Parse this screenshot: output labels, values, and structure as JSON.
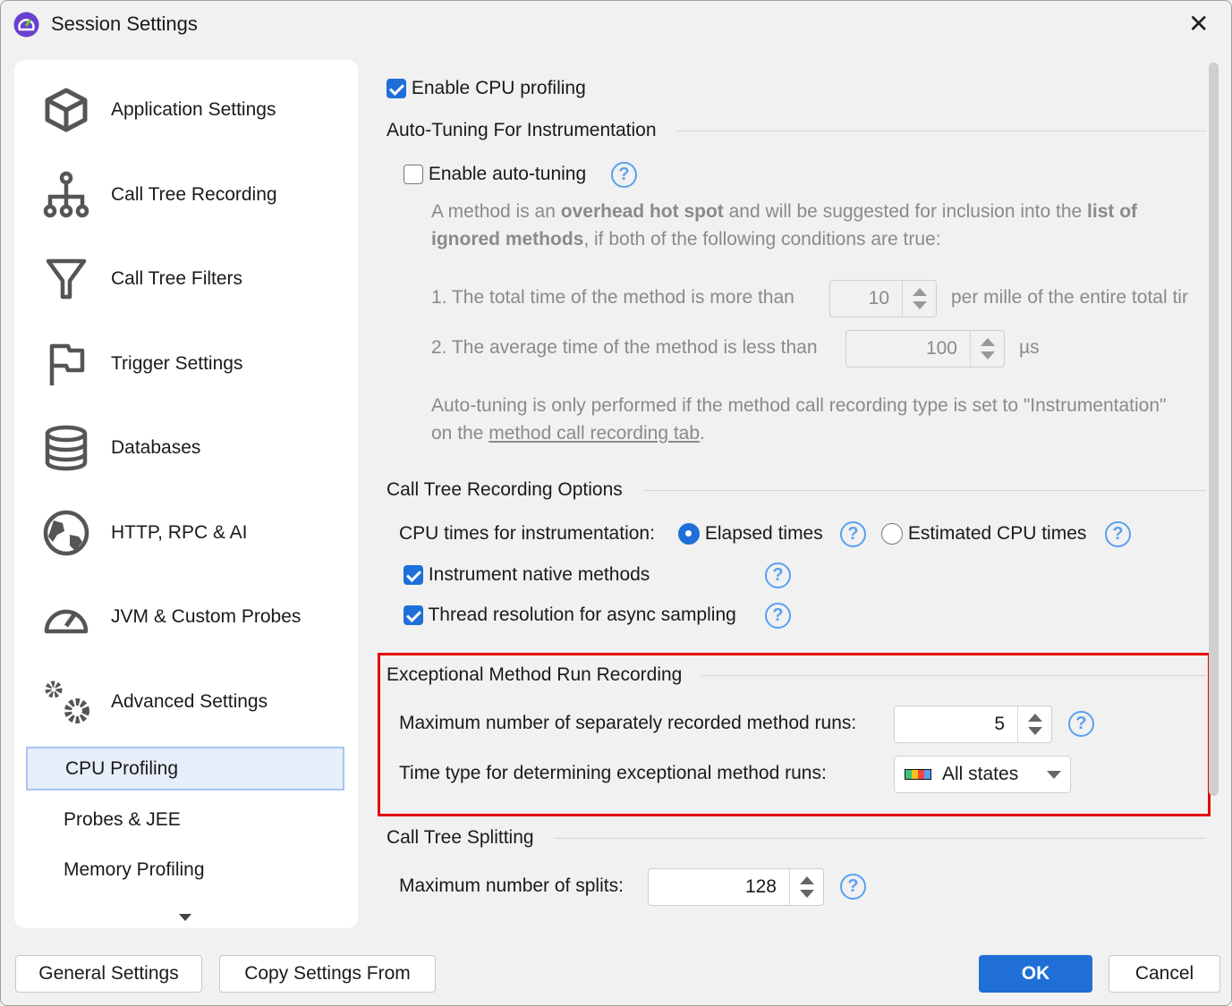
{
  "window": {
    "title": "Session Settings"
  },
  "sidebar": {
    "items": [
      {
        "label": "Application Settings"
      },
      {
        "label": "Call Tree Recording"
      },
      {
        "label": "Call Tree Filters"
      },
      {
        "label": "Trigger Settings"
      },
      {
        "label": "Databases"
      },
      {
        "label": "HTTP, RPC & AI"
      },
      {
        "label": "JVM & Custom Probes"
      },
      {
        "label": "Advanced Settings"
      }
    ],
    "subitems": [
      {
        "label": "CPU Profiling",
        "selected": true
      },
      {
        "label": "Probes & JEE"
      },
      {
        "label": "Memory Profiling"
      }
    ]
  },
  "main": {
    "enable_cpu": {
      "label": "Enable CPU profiling",
      "checked": true
    },
    "autotune": {
      "title": "Auto-Tuning For Instrumentation",
      "enable_label": "Enable auto-tuning",
      "checked": false,
      "desc_1": "A method is an ",
      "desc_b1": "overhead hot spot",
      "desc_2": " and will be suggested for inclusion into the ",
      "desc_b2": "list of",
      "desc_b3": "ignored methods",
      "desc_3": ", if both of the following conditions are true:",
      "cond1": "1. The total time of the method is more than",
      "cond1_value": "10",
      "cond1_unit": "per mille of the entire total tir",
      "cond2": "2. The average time of the method is less than",
      "cond2_value": "100",
      "cond2_unit": "µs",
      "note_1": "Auto-tuning is only performed if the method call recording type is set to \"Instrumentation\"",
      "note_2": "on the ",
      "note_link": "method call recording tab",
      "note_3": "."
    },
    "recording": {
      "title": "Call Tree Recording Options",
      "cpu_times_label": "CPU times for instrumentation:",
      "elapsed": "Elapsed times",
      "estimated": "Estimated CPU times",
      "selected": "Elapsed times",
      "native": {
        "label": "Instrument native methods",
        "checked": true
      },
      "thread": {
        "label": "Thread resolution for async sampling",
        "checked": true
      }
    },
    "exceptional": {
      "title": "Exceptional Method Run Recording",
      "max_label": "Maximum number of separately recorded method runs:",
      "max_value": "5",
      "time_label": "Time type for determining exceptional method runs:",
      "time_value": "All states"
    },
    "splitting": {
      "title": "Call Tree Splitting",
      "max_label": "Maximum number of splits:",
      "max_value": "128"
    }
  },
  "footer": {
    "general": "General Settings",
    "copy": "Copy Settings From",
    "ok": "OK",
    "cancel": "Cancel"
  },
  "colors": {
    "accent": "#1f6fd6",
    "highlight": "#e50000",
    "help": "#5aa0f0"
  }
}
